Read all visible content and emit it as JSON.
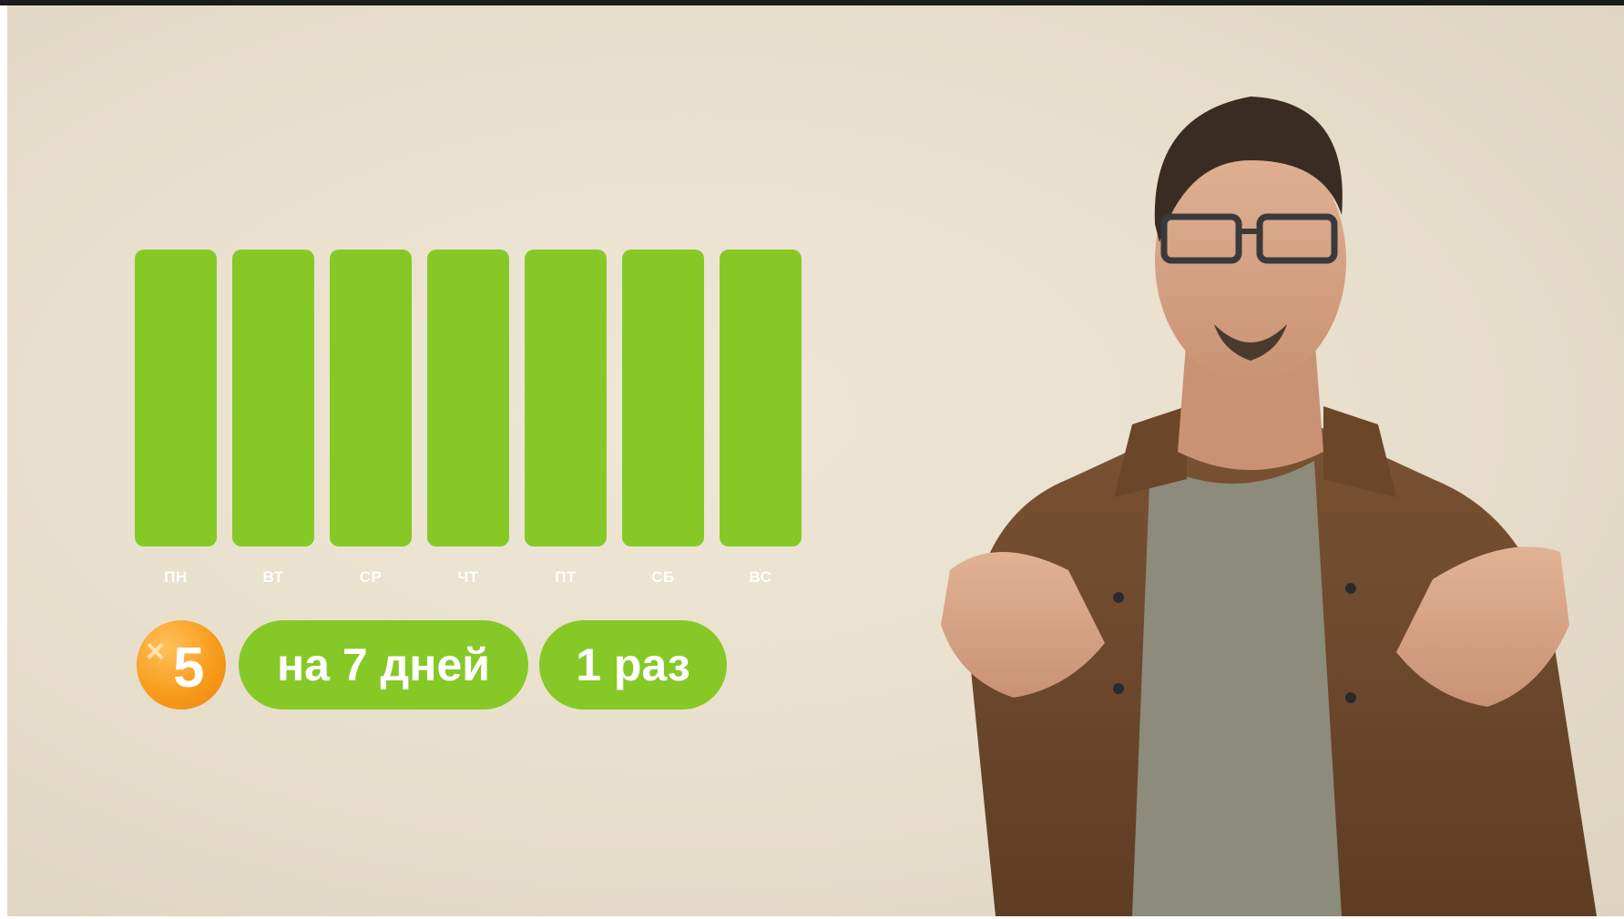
{
  "days": [
    "ПН",
    "ВТ",
    "СР",
    "ЧТ",
    "ПТ",
    "СБ",
    "ВС"
  ],
  "day_fill": [
    1,
    1,
    1,
    1,
    1,
    1,
    1
  ],
  "badges": {
    "multiplier_symbol": "×",
    "multiplier_value": "5",
    "duration": "на 7 дней",
    "frequency": "1 раз"
  },
  "colors": {
    "accent_green": "#86c927",
    "badge_orange": "#f89c1c",
    "background": "#e9e0cd",
    "text_white": "#ffffff"
  },
  "icons": {
    "multiplier": "x5-coin-icon",
    "presenter": "presenter-photo"
  }
}
